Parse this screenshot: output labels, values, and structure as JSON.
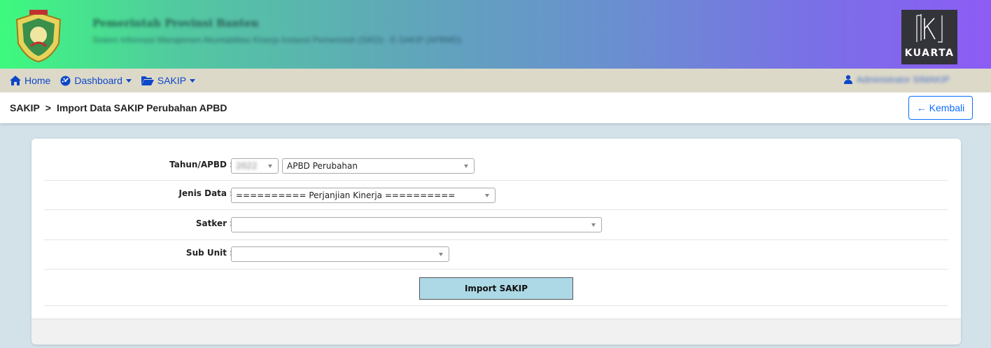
{
  "header": {
    "title": "Pemerintah Provinsi Banten",
    "subtitle": "Sistem Informasi Manajemen Akuntabilitas Kinerja Instansi Pemerintah (SIKD) - E-SAKIP (APBMD)",
    "brand_logo_text": "KUARTA"
  },
  "navbar": {
    "home": "Home",
    "dashboard": "Dashboard",
    "sakip": "SAKIP",
    "user_name": "Administrator SIMAKIP"
  },
  "breadcrumb": {
    "root": "SAKIP",
    "separator": ">",
    "current": "Import Data SAKIP Perubahan APBD"
  },
  "back_button": "← Kembali",
  "form": {
    "tahun_label": "Tahun/APBD :",
    "tahun_value": "2022",
    "apbd_value": "APBD Perubahan",
    "jenis_label": "Jenis Data :",
    "jenis_value": "========== Perjanjian Kinerja ==========",
    "satker_label": "Satker :",
    "satker_value": "",
    "subunit_label": "Sub Unit :",
    "subunit_value": "",
    "submit_label": "Import SAKIP"
  },
  "colors": {
    "link": "#0d47c9",
    "import_button": "#add8e6",
    "content_bg": "#d3e1e9",
    "navbar_bg": "#ddd9c9"
  }
}
